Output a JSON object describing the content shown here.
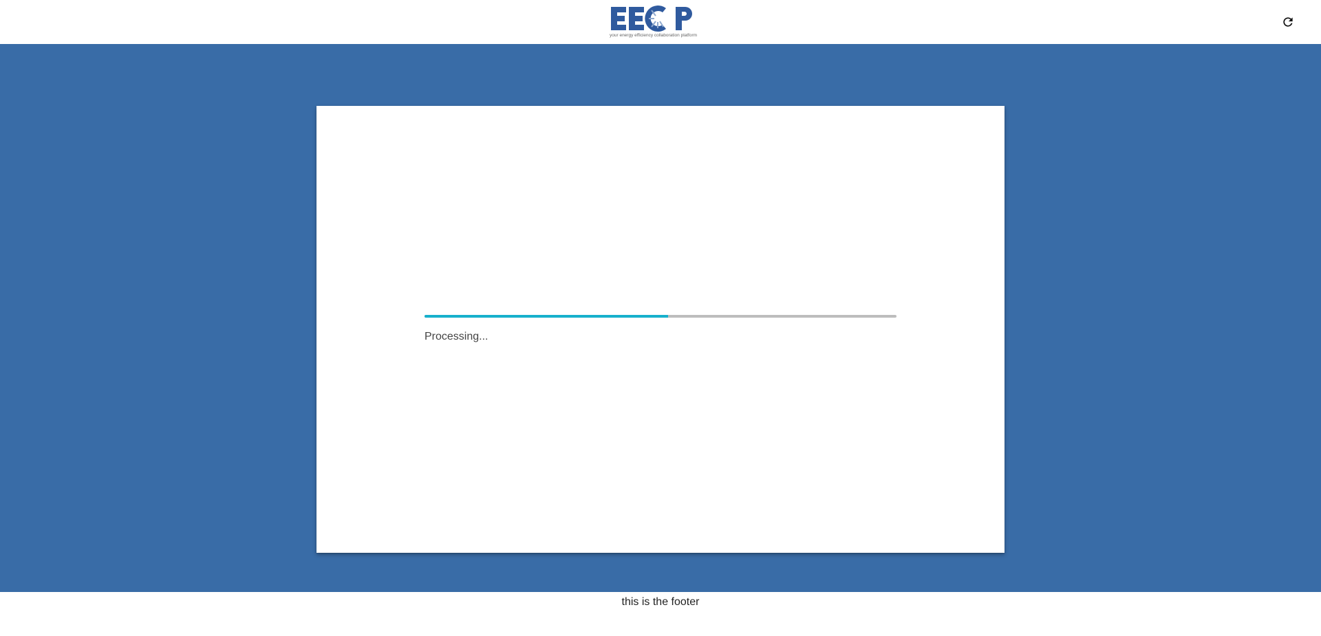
{
  "header": {
    "logo": {
      "wordmark": "EECP",
      "tagline": "your energy efficiency collaboration platform",
      "brand_color": "#2f5a9e",
      "accent_color": "#8fa9cf"
    },
    "refresh_icon": "refresh-icon"
  },
  "colors": {
    "main_background": "#396ca7",
    "card_background": "#ffffff",
    "progress_fill": "#17b0cc",
    "progress_track": "#bdbdbd"
  },
  "card": {
    "progress_fraction": 0.516,
    "status_text": "Processing..."
  },
  "footer": {
    "text": "this is the footer"
  }
}
